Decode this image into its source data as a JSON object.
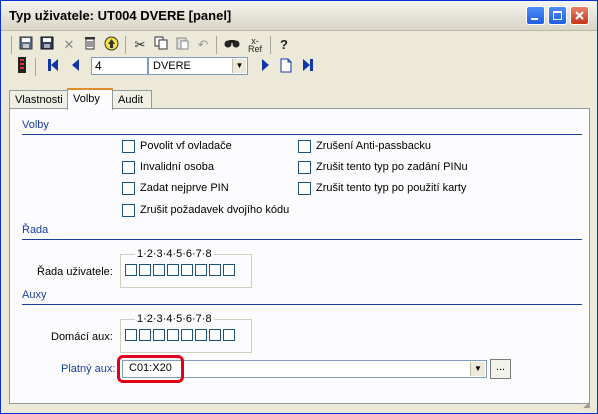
{
  "window": {
    "title": "Typ uživatele: UT004 DVERE [panel]",
    "controls": [
      "minimize-icon",
      "maximize-icon",
      "close-icon"
    ]
  },
  "toolbar1": {
    "icons": [
      "save-icon",
      "save-all-icon",
      "delete-icon",
      "trash-icon",
      "up-icon",
      "cut-icon",
      "copy-icon",
      "paste-icon",
      "undo-icon",
      "find-icon",
      "refresh-icon",
      "help-icon"
    ],
    "ref_label": "Ref"
  },
  "toolbar2": {
    "record_number": "4",
    "record_select": "DVERE"
  },
  "tabs": [
    {
      "label": "Vlastnosti",
      "active": false
    },
    {
      "label": "Volby",
      "active": true
    },
    {
      "label": "Audit",
      "active": false
    }
  ],
  "sections": {
    "volby": "Volby",
    "rada": "Řada",
    "auxy": "Auxy"
  },
  "options_left": [
    "Povolit vf ovladače",
    "Invalidní osoba",
    "Zadat nejprve PIN",
    "Zrušit požadavek dvojího kódu"
  ],
  "options_right": [
    "Zrušení Anti-passbacku",
    "Zrušit tento typ po zadání PINu",
    "Zrušit tento typ po použití karty"
  ],
  "bits_label": "1·2·3·4·5·6·7·8",
  "rada_label": "Řada uživatele:",
  "domaci_label": "Domácí aux:",
  "platny_label": "Platný aux:",
  "platny_value": "C01:X20",
  "ellipsis_label": "...",
  "colors": {
    "accent": "#1b3d9b",
    "highlight_ring": "#e3001b",
    "title_bg": "#ece9d8"
  }
}
